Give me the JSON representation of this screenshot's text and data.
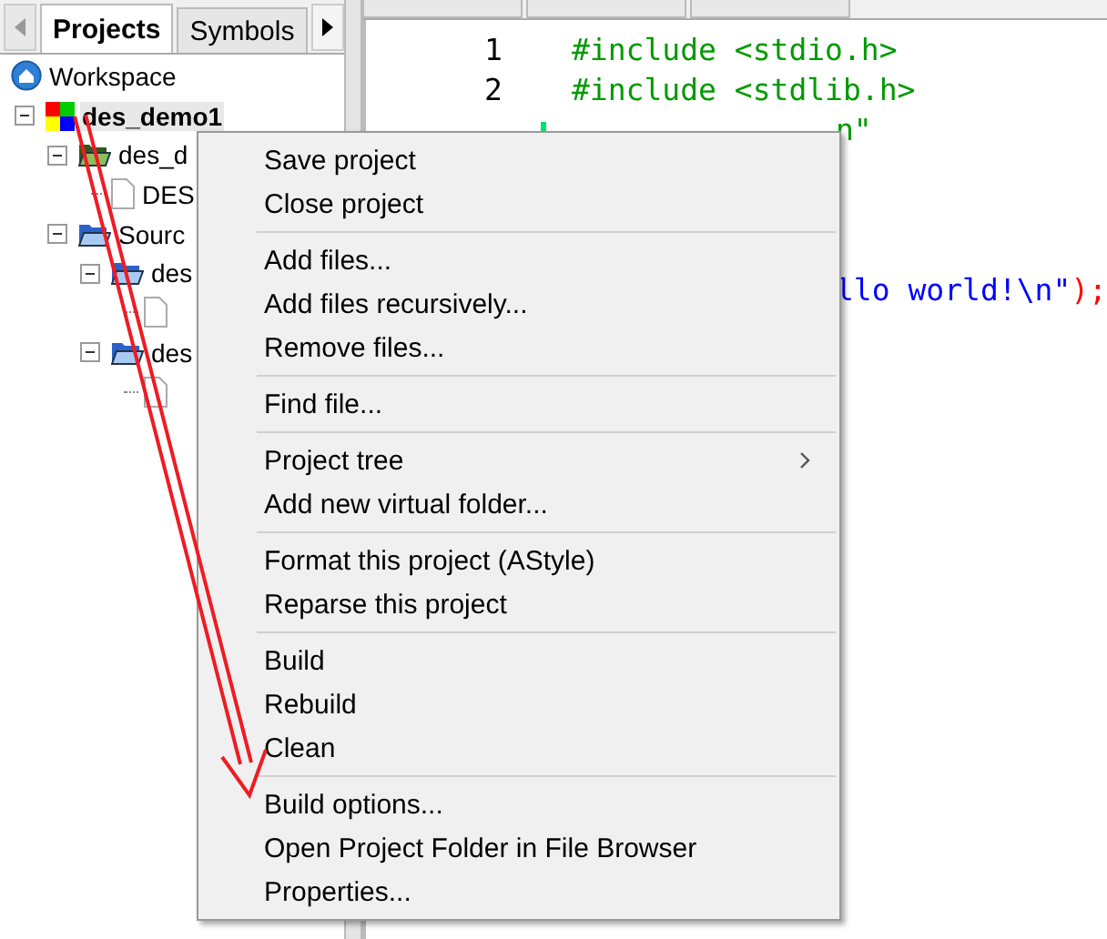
{
  "sidebar": {
    "tabs": [
      {
        "label": "Projects",
        "selected": true
      },
      {
        "label": "Symbols",
        "selected": false
      }
    ],
    "tree": [
      {
        "label": "Workspace",
        "kind": "workspace",
        "selected": false,
        "children": [
          {
            "label": "des_demo1",
            "kind": "project",
            "selected": true,
            "expanded": true,
            "children": [
              {
                "label": "des_d",
                "kind": "folder-green",
                "selected": false,
                "expanded": true,
                "children": [
                  {
                    "label": "DES",
                    "kind": "file",
                    "selected": false
                  }
                ]
              },
              {
                "label": "Sourc",
                "kind": "folder",
                "selected": false,
                "expanded": true,
                "children": [
                  {
                    "label": "des",
                    "kind": "folder",
                    "selected": false,
                    "expanded": true,
                    "children": [
                      {
                        "kind": "file",
                        "selected": false
                      }
                    ]
                  },
                  {
                    "label": "des",
                    "kind": "folder",
                    "selected": false,
                    "expanded": true,
                    "children": [
                      {
                        "kind": "file",
                        "selected": false
                      }
                    ]
                  }
                ]
              }
            ]
          }
        ]
      }
    ]
  },
  "editor": {
    "lines": [
      {
        "kind": "code",
        "number": "1",
        "segments": [
          {
            "text": "#include <stdio.h>",
            "kind": "preproc"
          }
        ]
      },
      {
        "kind": "code",
        "number": "2",
        "segments": [
          {
            "text": "#include <stdlib.h>",
            "kind": "preproc"
          }
        ]
      },
      {
        "kind": "code",
        "changed": true,
        "segments": [
          {
            "text": "n\"",
            "kind": "preproc"
          }
        ]
      },
      {
        "kind": "blank"
      },
      {
        "kind": "blank"
      },
      {
        "kind": "blank"
      },
      {
        "kind": "code",
        "segments": [
          {
            "text": "llo world!\\n\"",
            "kind": "string"
          },
          {
            "text": ");",
            "kind": "operator"
          }
        ]
      }
    ]
  },
  "context_menu": {
    "items": [
      {
        "kind": "item",
        "label": "Save project"
      },
      {
        "kind": "item",
        "label": "Close project"
      },
      {
        "kind": "separator"
      },
      {
        "kind": "item",
        "label": "Add files..."
      },
      {
        "kind": "item",
        "label": "Add files recursively..."
      },
      {
        "kind": "item",
        "label": "Remove files..."
      },
      {
        "kind": "separator"
      },
      {
        "kind": "item",
        "label": "Find file..."
      },
      {
        "kind": "separator"
      },
      {
        "kind": "item",
        "label": "Project tree",
        "submenu": true
      },
      {
        "kind": "item",
        "label": "Add new virtual folder..."
      },
      {
        "kind": "separator"
      },
      {
        "kind": "item",
        "label": "Format this project (AStyle)"
      },
      {
        "kind": "item",
        "label": "Reparse this project"
      },
      {
        "kind": "separator"
      },
      {
        "kind": "item",
        "label": "Build"
      },
      {
        "kind": "item",
        "label": "Rebuild"
      },
      {
        "kind": "item",
        "label": "Clean"
      },
      {
        "kind": "separator"
      },
      {
        "kind": "item",
        "label": "Build options..."
      },
      {
        "kind": "item",
        "label": "Open Project Folder in File Browser"
      },
      {
        "kind": "item",
        "label": "Properties..."
      }
    ]
  }
}
